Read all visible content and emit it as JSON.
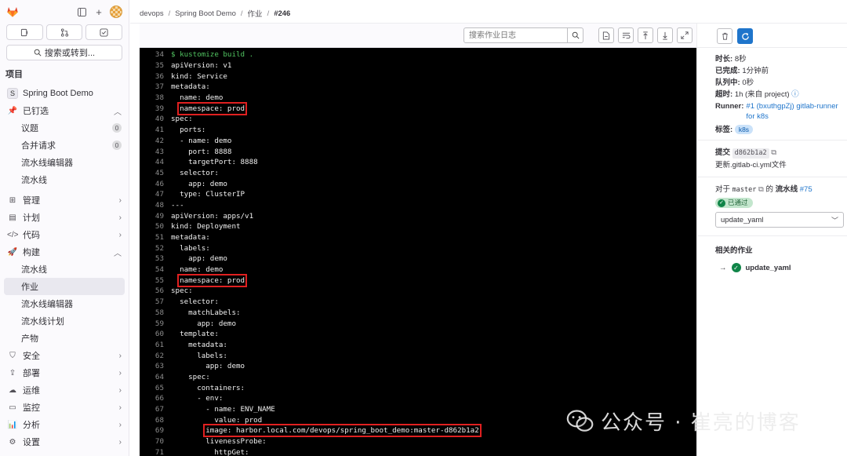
{
  "sidebar": {
    "search_label": "搜索或转到...",
    "section_title": "项目",
    "project_initial": "S",
    "project_name": "Spring Boot Demo",
    "pinned_label": "已钉选",
    "pinned_items": [
      {
        "label": "议题",
        "count": "0"
      },
      {
        "label": "合并请求",
        "count": "0"
      },
      {
        "label": "流水线编辑器"
      },
      {
        "label": "流水线"
      }
    ],
    "manage": "管理",
    "plan": "计划",
    "code": "代码",
    "build": "构建",
    "build_items": [
      "流水线",
      "作业",
      "流水线编辑器",
      "流水线计划",
      "产物"
    ],
    "secure": "安全",
    "deploy": "部署",
    "operate": "运维",
    "monitor": "监控",
    "analyze": "分析",
    "settings": "设置"
  },
  "breadcrumb": [
    "devops",
    "Spring Boot Demo",
    "作业",
    "#246"
  ],
  "log_toolbar": {
    "search_placeholder": "搜索作业日志"
  },
  "log_lines": [
    {
      "n": "34",
      "t": "$ kustomize build .",
      "cmd": true
    },
    {
      "n": "35",
      "t": "apiVersion: v1"
    },
    {
      "n": "36",
      "t": "kind: Service"
    },
    {
      "n": "37",
      "t": "metadata:"
    },
    {
      "n": "38",
      "t": "  name: demo"
    },
    {
      "n": "39",
      "t": "  namespace: prod",
      "hl": true
    },
    {
      "n": "40",
      "t": "spec:"
    },
    {
      "n": "41",
      "t": "  ports:"
    },
    {
      "n": "42",
      "t": "  - name: demo"
    },
    {
      "n": "43",
      "t": "    port: 8888"
    },
    {
      "n": "44",
      "t": "    targetPort: 8888"
    },
    {
      "n": "45",
      "t": "  selector:"
    },
    {
      "n": "46",
      "t": "    app: demo"
    },
    {
      "n": "47",
      "t": "  type: ClusterIP"
    },
    {
      "n": "48",
      "t": "---"
    },
    {
      "n": "49",
      "t": "apiVersion: apps/v1"
    },
    {
      "n": "50",
      "t": "kind: Deployment"
    },
    {
      "n": "51",
      "t": "metadata:"
    },
    {
      "n": "52",
      "t": "  labels:"
    },
    {
      "n": "53",
      "t": "    app: demo"
    },
    {
      "n": "54",
      "t": "  name: demo"
    },
    {
      "n": "55",
      "t": "  namespace: prod",
      "hl": true
    },
    {
      "n": "56",
      "t": "spec:"
    },
    {
      "n": "57",
      "t": "  selector:"
    },
    {
      "n": "58",
      "t": "    matchLabels:"
    },
    {
      "n": "59",
      "t": "      app: demo"
    },
    {
      "n": "60",
      "t": "  template:"
    },
    {
      "n": "61",
      "t": "    metadata:"
    },
    {
      "n": "62",
      "t": "      labels:"
    },
    {
      "n": "63",
      "t": "        app: demo"
    },
    {
      "n": "64",
      "t": "    spec:"
    },
    {
      "n": "65",
      "t": "      containers:"
    },
    {
      "n": "66",
      "t": "      - env:"
    },
    {
      "n": "67",
      "t": "        - name: ENV_NAME"
    },
    {
      "n": "68",
      "t": "          value: prod"
    },
    {
      "n": "69",
      "t": "        image: harbor.local.com/devops/spring_boot_demo:master-d862b1a2",
      "hl": true
    },
    {
      "n": "70",
      "t": "        livenessProbe:"
    },
    {
      "n": "71",
      "t": "          httpGet:"
    }
  ],
  "job": {
    "duration_label": "时长:",
    "duration": "8秒",
    "finished_label": "已完成:",
    "finished": "1分钟前",
    "queued_label": "队列中:",
    "queued": "0秒",
    "timeout_label": "超时:",
    "timeout": "1h (来自 project)",
    "runner_label": "Runner:",
    "runner": "#1 (bxuthgpZj) gitlab-runner for k8s",
    "tags_label": "标签:",
    "tag": "k8s",
    "commit_label": "提交",
    "commit_sha": "d862b1a2",
    "commit_msg": "更新.gitlab-ci.yml文件",
    "pipeline_prefix": "对于",
    "branch": "master",
    "pipeline_of": "的",
    "pipeline_label": "流水线",
    "pipeline_id": "#75",
    "status": "已通过",
    "stage_select": "update_yaml",
    "related_title": "相关的作业",
    "related_job": "update_yaml"
  },
  "watermark": {
    "text": "公众号 · 崔亮的博客"
  },
  "colors": {
    "accent": "#1f75cb",
    "success": "#108548",
    "highlight_box": "#e02020"
  }
}
